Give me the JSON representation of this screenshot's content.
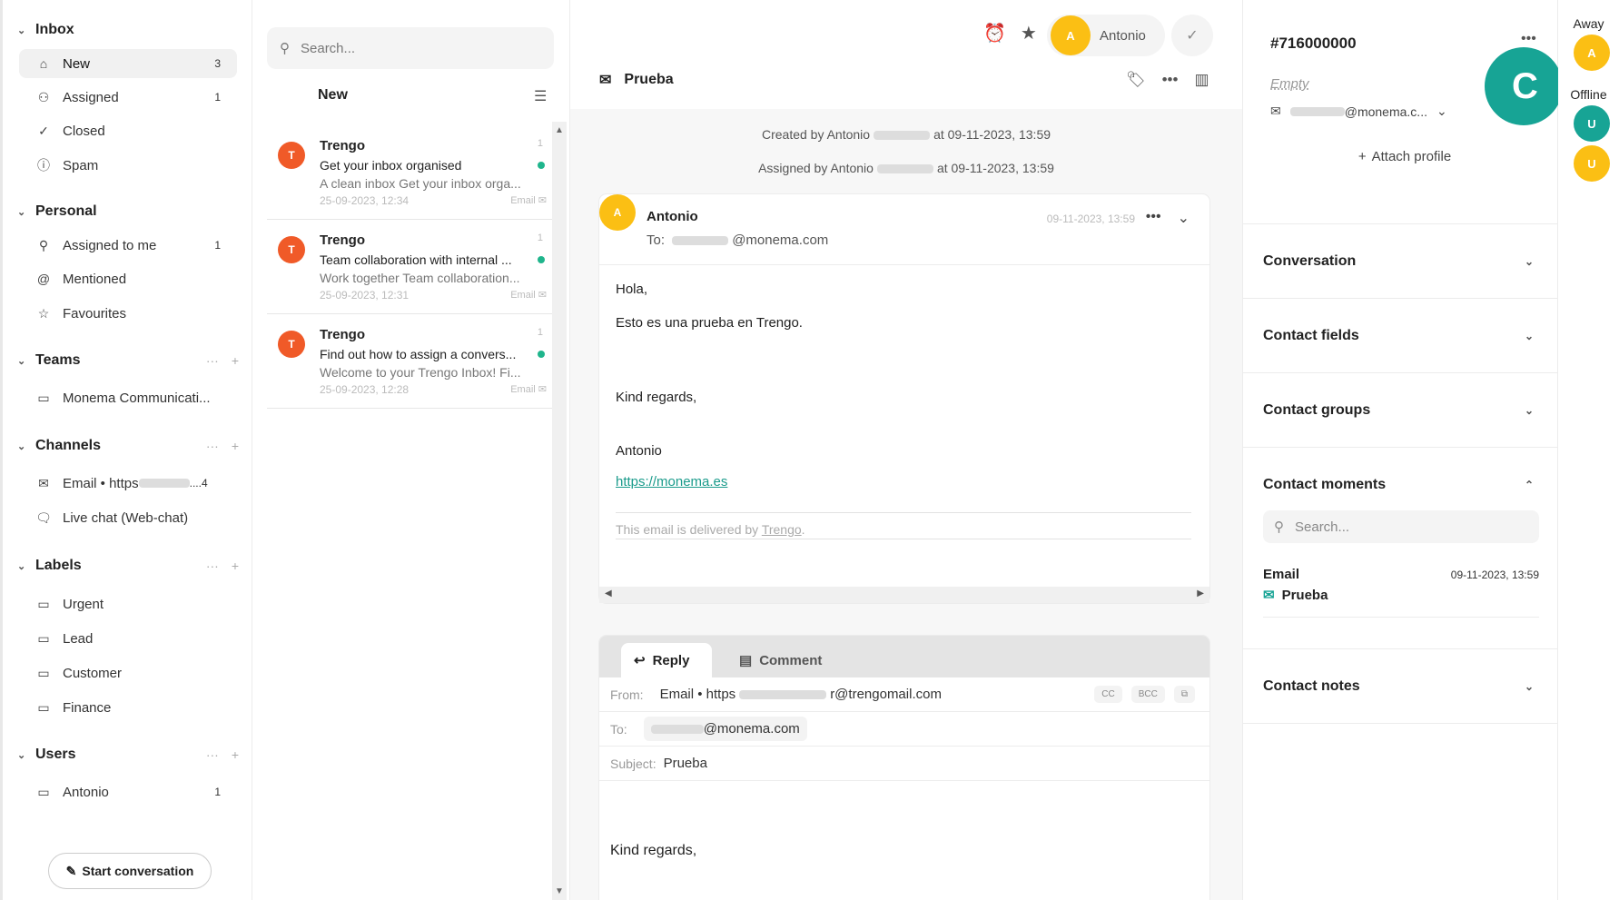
{
  "sidebar": {
    "inbox_title": "Inbox",
    "inbox_items": [
      {
        "label": "New",
        "count": "3"
      },
      {
        "label": "Assigned",
        "count": "1"
      },
      {
        "label": "Closed",
        "count": ""
      },
      {
        "label": "Spam",
        "count": ""
      }
    ],
    "personal_title": "Personal",
    "personal_items": [
      {
        "label": "Assigned to me",
        "count": "1"
      },
      {
        "label": "Mentioned",
        "count": ""
      },
      {
        "label": "Favourites",
        "count": ""
      }
    ],
    "teams_title": "Teams",
    "teams_items": [
      {
        "label": "Monema Communicati..."
      }
    ],
    "channels_title": "Channels",
    "channels_items": [
      {
        "label": "Email • https",
        "suffix": "....4"
      },
      {
        "label": "Live chat (Web-chat)"
      }
    ],
    "labels_title": "Labels",
    "labels_items": [
      {
        "label": "Urgent"
      },
      {
        "label": "Lead"
      },
      {
        "label": "Customer"
      },
      {
        "label": "Finance"
      }
    ],
    "users_title": "Users",
    "users_items": [
      {
        "label": "Antonio",
        "count": "1"
      }
    ],
    "start_button": "Start conversation",
    "section_more": "···",
    "section_add": "+"
  },
  "list": {
    "search_placeholder": "Search...",
    "title": "New",
    "conversations": [
      {
        "avatar": "T",
        "name": "Trengo",
        "subject": "Get your inbox organised",
        "preview": "A clean inbox Get your inbox orga...",
        "date": "25-09-2023, 12:34",
        "channel": "Email",
        "count": "1"
      },
      {
        "avatar": "T",
        "name": "Trengo",
        "subject": "Team collaboration with internal ...",
        "preview": "Work together Team collaboration...",
        "date": "25-09-2023, 12:31",
        "channel": "Email",
        "count": "1"
      },
      {
        "avatar": "T",
        "name": "Trengo",
        "subject": "Find out how to assign a convers...",
        "preview": "Welcome to your Trengo Inbox! Fi...",
        "date": "25-09-2023, 12:28",
        "channel": "Email",
        "count": "1"
      }
    ]
  },
  "conversation": {
    "assignee_initial": "A",
    "assignee_name": "Antonio",
    "title": "Prueba",
    "created_prefix": "Created by Antonio",
    "created_suffix": "at 09-11-2023, 13:59",
    "assigned_prefix": "Assigned by Antonio",
    "assigned_suffix": "at 09-11-2023, 13:59",
    "message": {
      "avatar": "A",
      "from": "Antonio",
      "to_label": "To:",
      "to_value": "@monema.com",
      "time": "09-11-2023, 13:59",
      "greeting": "Hola,",
      "line1": "Esto es una prueba en Trengo.",
      "regards": "Kind regards,",
      "signature": "Antonio",
      "link": "https://monema.es",
      "footer_prefix": "This email is delivered by",
      "footer_link": "Trengo",
      "footer_suffix": "."
    },
    "reply": {
      "tab_reply": "Reply",
      "tab_comment": "Comment",
      "from_label": "From:",
      "from_value_prefix": "Email • https",
      "from_value_suffix": "r@trengomail.com",
      "cc": "CC",
      "bcc": "BCC",
      "to_label": "To:",
      "to_value": "@monema.com",
      "subject_label": "Subject:",
      "subject_value": "Prueba",
      "body": "Kind regards,"
    }
  },
  "contact": {
    "id": "#716000000",
    "empty": "Empty",
    "email_suffix": "@monema.c...",
    "avatar": "C",
    "attach": "Attach profile",
    "sections": [
      "Conversation",
      "Contact fields",
      "Contact groups",
      "Contact moments",
      "Contact notes"
    ],
    "moments_search": "Search...",
    "moment": {
      "type": "Email",
      "time": "09-11-2023, 13:59",
      "title": "Prueba"
    }
  },
  "rail": {
    "away_label": "Away",
    "away_users": [
      "A"
    ],
    "offline_label": "Offline",
    "offline_users": [
      "U",
      "U"
    ]
  }
}
